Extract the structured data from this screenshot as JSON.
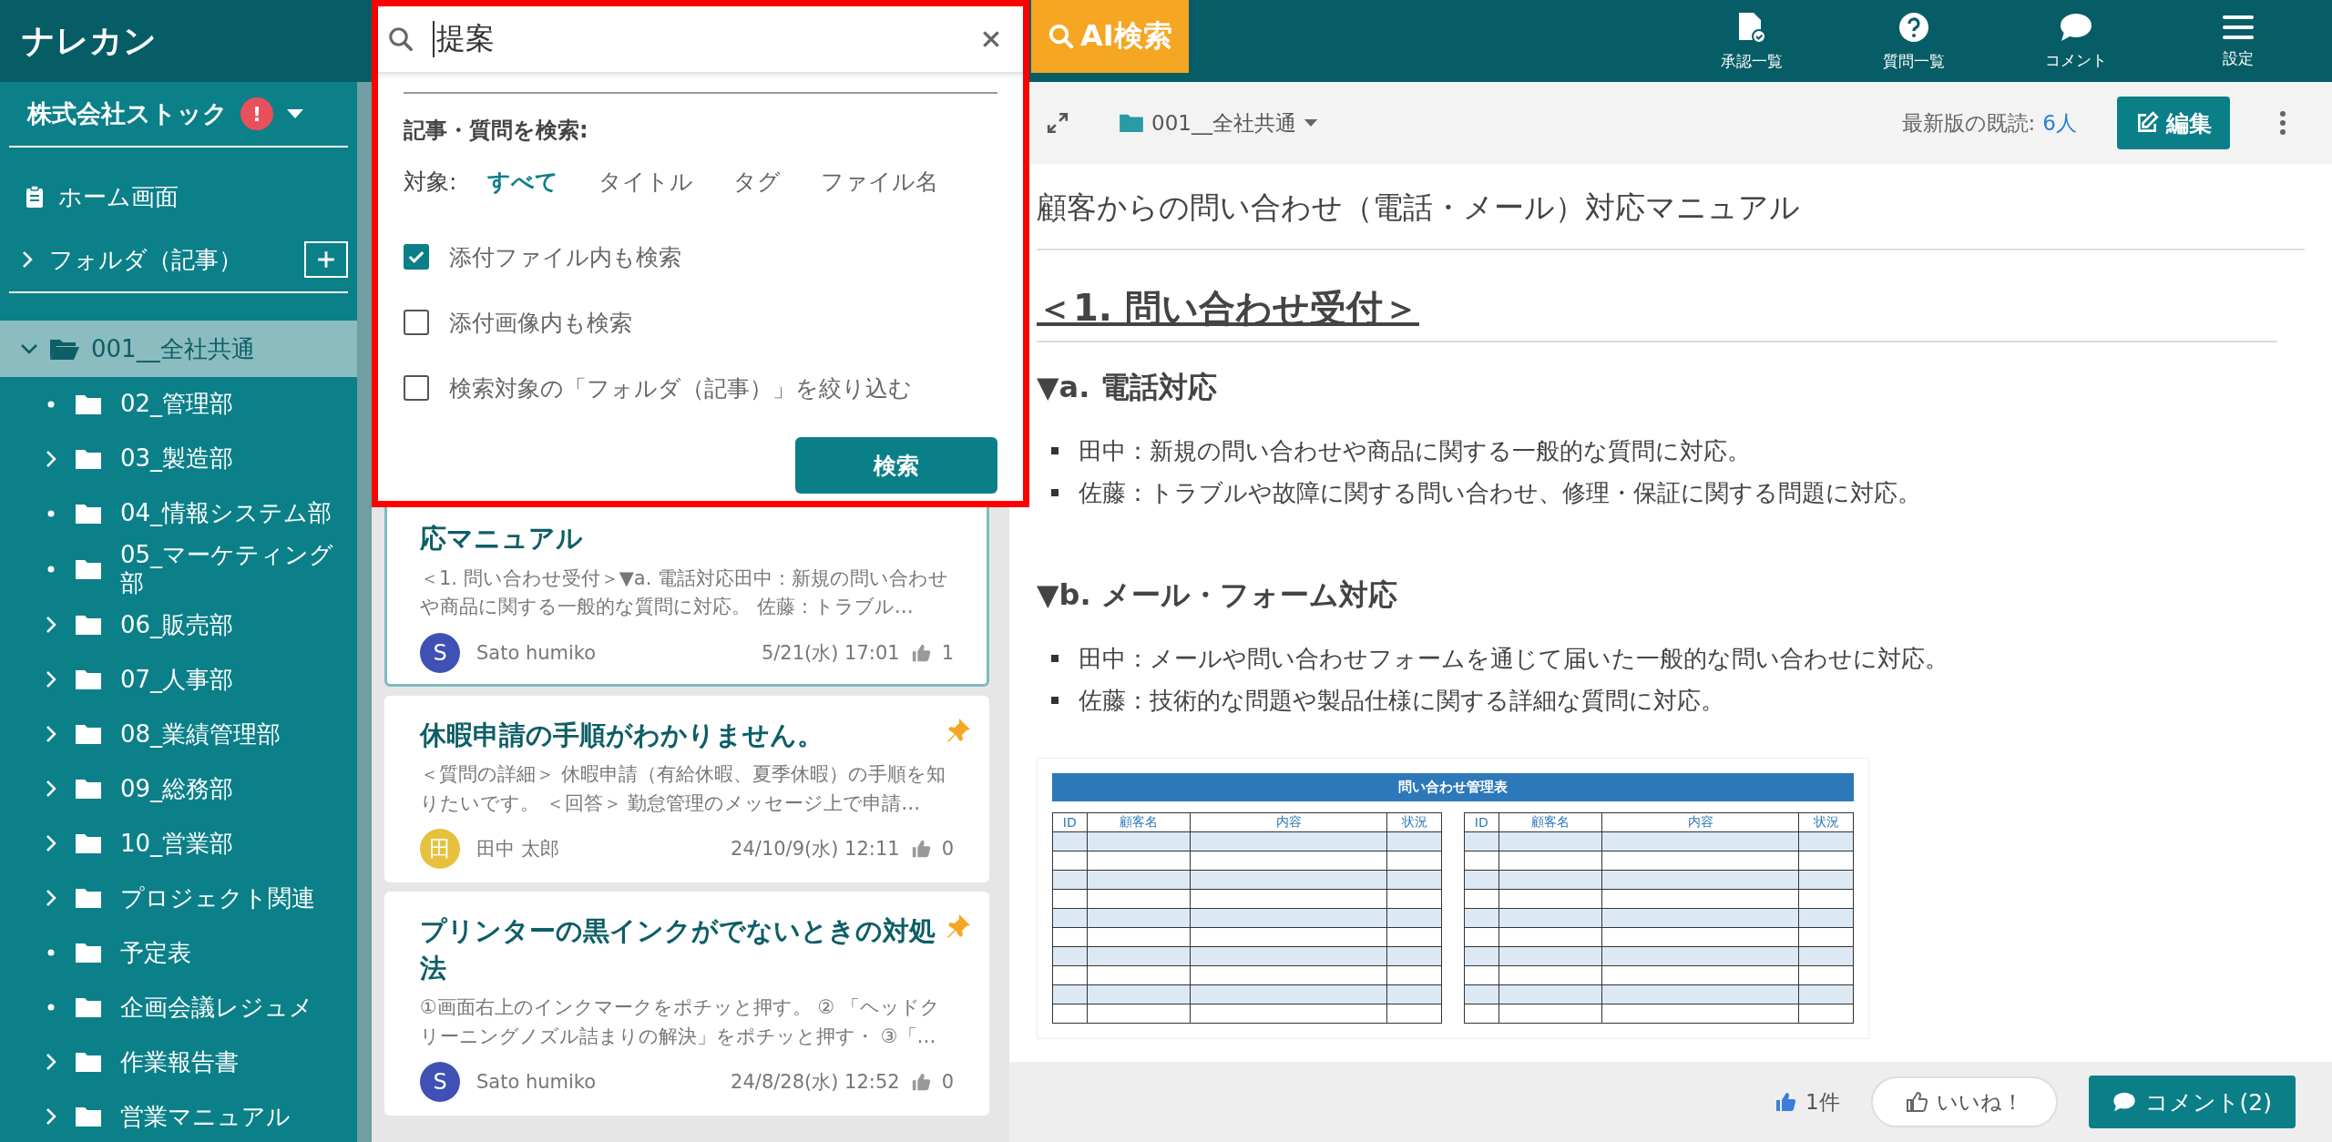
{
  "header": {
    "logo": "ナレカン",
    "search": {
      "value": "提案"
    },
    "ai_button": "AI検索",
    "nav": [
      {
        "label": "承認一覧",
        "kind": "approval"
      },
      {
        "label": "質問一覧",
        "kind": "question"
      },
      {
        "label": "コメント",
        "kind": "comment"
      },
      {
        "label": "設定",
        "kind": "menu"
      }
    ]
  },
  "search_panel": {
    "heading": "記事・質問を検索:",
    "target_label": "対象:",
    "targets": [
      {
        "label": "すべて",
        "selected": true
      },
      {
        "label": "タイトル",
        "selected": false
      },
      {
        "label": "タグ",
        "selected": false
      },
      {
        "label": "ファイル名",
        "selected": false
      }
    ],
    "options": [
      {
        "label": "添付ファイル内も検索",
        "checked": true
      },
      {
        "label": "添付画像内も検索",
        "checked": false
      },
      {
        "label": "検索対象の「フォルダ（記事）」を絞り込む",
        "checked": false
      }
    ],
    "submit": "検索"
  },
  "sidebar": {
    "company": "株式会社ストック",
    "alert": "!",
    "home": "ホーム画面",
    "folder_section": "フォルダ（記事）",
    "tree": [
      {
        "label": "001__全社共通",
        "expanded": true,
        "selected": true,
        "children": [
          {
            "label": "02_管理部",
            "expandable": false
          },
          {
            "label": "03_製造部",
            "expandable": true
          },
          {
            "label": "04_情報システム部",
            "expandable": false
          },
          {
            "label": "05_マーケティング部",
            "expandable": false
          },
          {
            "label": "06_販売部",
            "expandable": true
          },
          {
            "label": "07_人事部",
            "expandable": true
          },
          {
            "label": "08_業績管理部",
            "expandable": true
          },
          {
            "label": "09_総務部",
            "expandable": true
          },
          {
            "label": "10_営業部",
            "expandable": true
          },
          {
            "label": "プロジェクト関連",
            "expandable": true
          },
          {
            "label": "予定表",
            "expandable": false
          },
          {
            "label": "企画会議レジュメ",
            "expandable": false
          },
          {
            "label": "作業報告書",
            "expandable": true
          },
          {
            "label": "営業マニュアル",
            "expandable": true
          }
        ]
      }
    ]
  },
  "articles": [
    {
      "title": "応マニュアル",
      "excerpt": "＜1. 問い合わせ受付＞▼a. 電話対応田中：新規の問い合わせや商品に関する一般的な質問に対応。 佐藤：トラブル…",
      "author": "Sato humiko",
      "avatar": "S",
      "color": "#3f51b5",
      "date": "5/21(水) 17:01",
      "likes": "1",
      "pinned": false,
      "selected": true
    },
    {
      "title": "休暇申請の手順がわかりません。",
      "excerpt": "＜質問の詳細＞ 休暇申請（有給休暇、夏季休暇）の手順を知りたいです。 ＜回答＞ 勤怠管理のメッセージ上で申請…",
      "author": "田中 太郎",
      "avatar": "田",
      "color": "#e6c13d",
      "date": "24/10/9(水) 12:11",
      "likes": "0",
      "pinned": true,
      "selected": false
    },
    {
      "title": "プリンターの黒インクがでないときの対処法",
      "excerpt": "①画面右上のインクマークをポチッと押す。 ② 「ヘッドクリーニングノズル詰まりの解決」をポチッと押す・ ③「…",
      "author": "Sato humiko",
      "avatar": "S",
      "color": "#3f51b5",
      "date": "24/8/28(水) 12:52",
      "likes": "0",
      "pinned": true,
      "selected": false
    }
  ],
  "document": {
    "breadcrumb": "001__全社共通",
    "read_label": "最新版の既読:",
    "read_count": "6人",
    "edit_button": "編集",
    "title": "顧客からの問い合わせ（電話・メール）対応マニュアル",
    "heading": "＜1. 問い合わせ受付＞",
    "sections": [
      {
        "heading": "▼a. 電話対応",
        "items": [
          "田中：新規の問い合わせや商品に関する一般的な質問に対応。",
          "佐藤：トラブルや故障に関する問い合わせ、修理・保証に関する問題に対応。"
        ]
      },
      {
        "heading": "▼b. メール・フォーム対応",
        "items": [
          "田中：メールや問い合わせフォームを通じて届いた一般的な問い合わせに対応。",
          "佐藤：技術的な問題や製品仕様に関する詳細な質問に対応。"
        ]
      }
    ],
    "image": {
      "title": "問い合わせ管理表",
      "tables": [
        {
          "columns": [
            "ID",
            "顧客名",
            "内容",
            "状況"
          ]
        },
        {
          "columns": [
            "ID",
            "顧客名",
            "内容",
            "状況"
          ]
        }
      ]
    }
  },
  "footer": {
    "likes": "1件",
    "like_button": "いいね！",
    "comment_button": "コメント(2)"
  }
}
